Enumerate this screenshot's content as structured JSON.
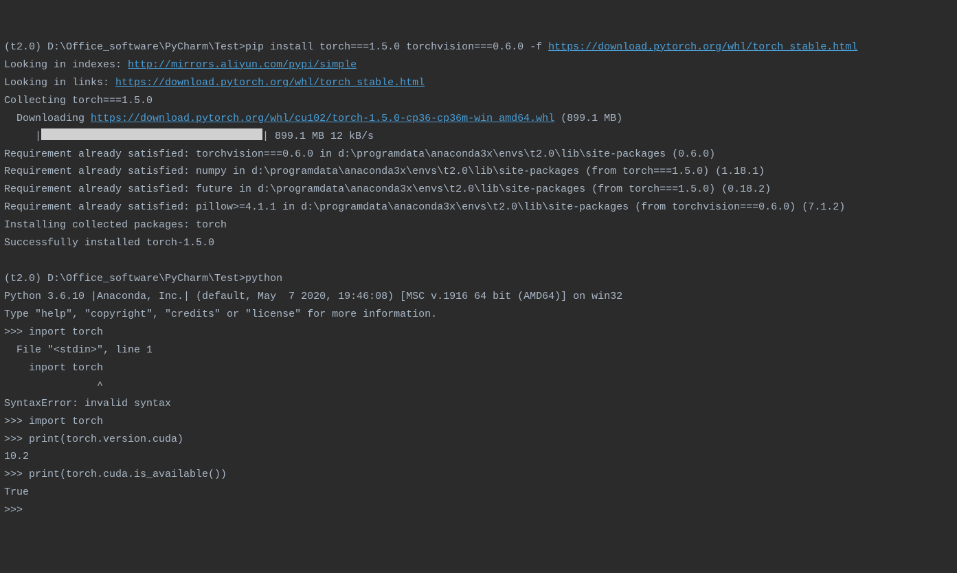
{
  "lines": {
    "l1_prompt": "(t2.0) D:\\Office_software\\PyCharm\\Test>pip install torch===1.5.0 torchvision===0.6.0 -f ",
    "l1_link": "https://download.pytorch.org/whl/torch_stable.html",
    "l2_text": "Looking in indexes: ",
    "l2_link": "http://mirrors.aliyun.com/pypi/simple",
    "l3_text": "Looking in links: ",
    "l3_link": "https://download.pytorch.org/whl/torch_stable.html",
    "l4": "Collecting torch===1.5.0",
    "l5_text": "  Downloading ",
    "l5_link": "https://download.pytorch.org/whl/cu102/torch-1.5.0-cp36-cp36m-win_amd64.whl",
    "l5_suffix": " (899.1 MB)",
    "l6_prefix": "     |",
    "l6_suffix": "| 899.1 MB 12 kB/s",
    "l7": "Requirement already satisfied: torchvision===0.6.0 in d:\\programdata\\anaconda3x\\envs\\t2.0\\lib\\site-packages (0.6.0)",
    "l8": "Requirement already satisfied: numpy in d:\\programdata\\anaconda3x\\envs\\t2.0\\lib\\site-packages (from torch===1.5.0) (1.18.1)",
    "l9": "Requirement already satisfied: future in d:\\programdata\\anaconda3x\\envs\\t2.0\\lib\\site-packages (from torch===1.5.0) (0.18.2)",
    "l10": "Requirement already satisfied: pillow>=4.1.1 in d:\\programdata\\anaconda3x\\envs\\t2.0\\lib\\site-packages (from torchvision===0.6.0) (7.1.2)",
    "l11": "Installing collected packages: torch",
    "l12": "Successfully installed torch-1.5.0",
    "l13": " ",
    "l14": "(t2.0) D:\\Office_software\\PyCharm\\Test>python",
    "l15": "Python 3.6.10 |Anaconda, Inc.| (default, May  7 2020, 19:46:08) [MSC v.1916 64 bit (AMD64)] on win32",
    "l16": "Type \"help\", \"copyright\", \"credits\" or \"license\" for more information.",
    "l17": ">>> inport torch",
    "l18": "  File \"<stdin>\", line 1",
    "l19": "    inport torch",
    "l20": "               ^",
    "l21": "SyntaxError: invalid syntax",
    "l22": ">>> import torch",
    "l23": ">>> print(torch.version.cuda)",
    "l24": "10.2",
    "l25": ">>> print(torch.cuda.is_available())",
    "l26": "True",
    "l27": ">>> "
  }
}
